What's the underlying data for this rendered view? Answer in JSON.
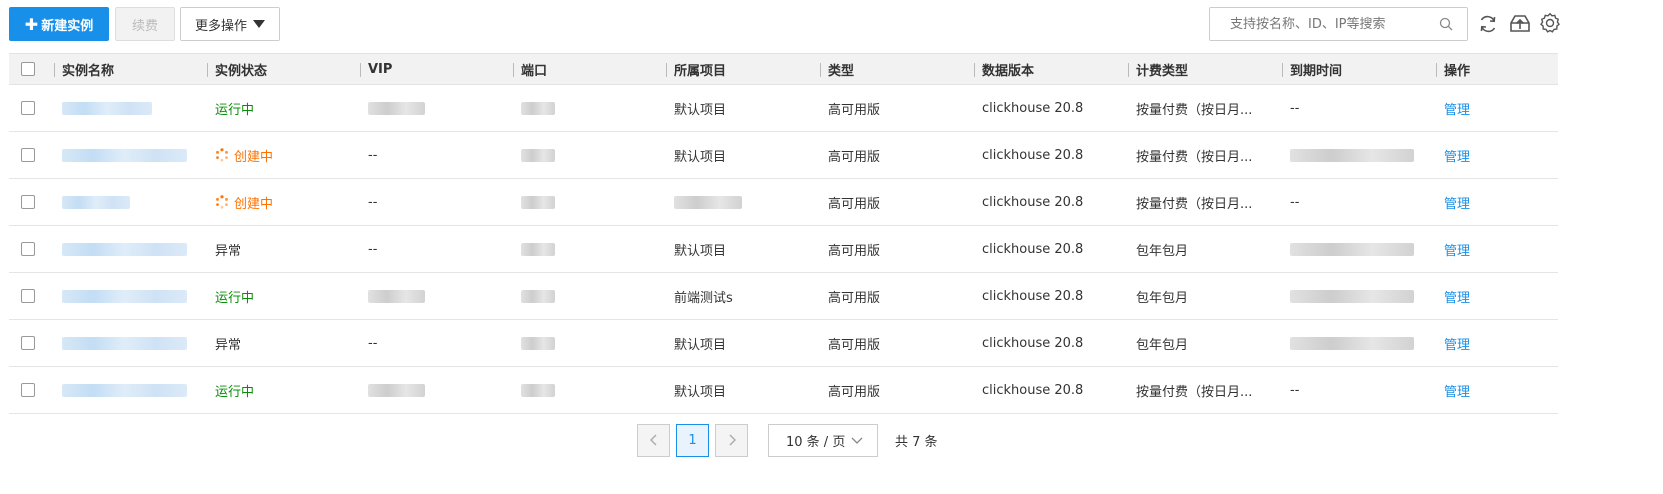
{
  "toolbar": {
    "create_label": "新建实例",
    "renew_label": "续费",
    "more_label": "更多操作",
    "search_placeholder": "支持按名称、ID、IP等搜索"
  },
  "table": {
    "columns": [
      "实例名称",
      "实例状态",
      "VIP",
      "端口",
      "所属项目",
      "类型",
      "数据版本",
      "计费类型",
      "到期时间",
      "操作"
    ],
    "rows": [
      {
        "status": "运行中",
        "status_type": "running",
        "vip": "",
        "project": "默认项目",
        "type": "高可用版",
        "version": "clickhouse 20.8",
        "billing": "按量付费（按日月...",
        "expire": "--",
        "action": "管理"
      },
      {
        "status": "创建中",
        "status_type": "creating",
        "vip": "--",
        "project": "默认项目",
        "type": "高可用版",
        "version": "clickhouse 20.8",
        "billing": "按量付费（按日月...",
        "expire": "",
        "action": "管理"
      },
      {
        "status": "创建中",
        "status_type": "creating",
        "vip": "--",
        "project": "",
        "type": "高可用版",
        "version": "clickhouse 20.8",
        "billing": "按量付费（按日月...",
        "expire": "--",
        "action": "管理"
      },
      {
        "status": "异常",
        "status_type": "error",
        "vip": "--",
        "project": "默认项目",
        "type": "高可用版",
        "version": "clickhouse 20.8",
        "billing": "包年包月",
        "expire": "",
        "action": "管理"
      },
      {
        "status": "运行中",
        "status_type": "running",
        "vip": "",
        "project": "前端测试s",
        "type": "高可用版",
        "version": "clickhouse 20.8",
        "billing": "包年包月",
        "expire": "",
        "action": "管理"
      },
      {
        "status": "异常",
        "status_type": "error",
        "vip": "--",
        "project": "默认项目",
        "type": "高可用版",
        "version": "clickhouse 20.8",
        "billing": "包年包月",
        "expire": "",
        "action": "管理"
      },
      {
        "status": "运行中",
        "status_type": "running",
        "vip": "",
        "project": "默认项目",
        "type": "高可用版",
        "version": "clickhouse 20.8",
        "billing": "按量付费（按日月...",
        "expire": "--",
        "action": "管理"
      }
    ]
  },
  "pagination": {
    "current_page": "1",
    "page_size_label": "10 条 / 页",
    "total_label": "共 7 条"
  },
  "colors": {
    "primary": "#1890e9",
    "running": "#0a8c0a",
    "creating": "#ff7200"
  },
  "icons": [
    "search-icon",
    "refresh-icon",
    "upload-icon",
    "gear-icon",
    "chevron-left-icon",
    "chevron-right-icon",
    "chevron-down-icon",
    "spinner-icon",
    "caret-down-icon"
  ]
}
